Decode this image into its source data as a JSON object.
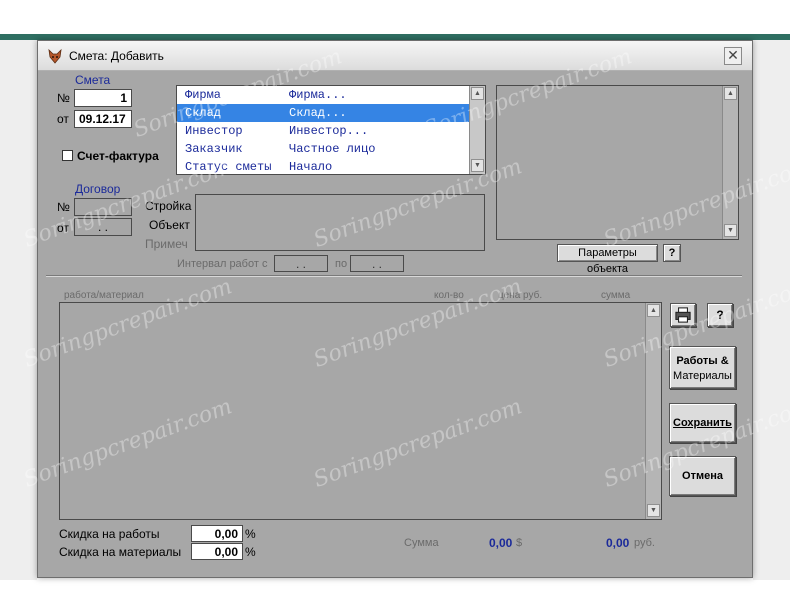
{
  "window": {
    "title": "Смета: Добавить",
    "close_symbol": "✕"
  },
  "estimate": {
    "group_label": "Смета",
    "number_label": "№",
    "number_value": "1",
    "date_label": "от",
    "date_value": "09.12.17",
    "invoice_label": "Счет-фактура",
    "invoice_checked": false
  },
  "contract": {
    "group_label": "Договор",
    "number_label": "№",
    "number_value": "",
    "date_label": "от",
    "date_value": ". ."
  },
  "parties_list": {
    "rows": [
      {
        "name": "Фирма",
        "value": "Фирма...",
        "selected": false
      },
      {
        "name": "Склад",
        "value": "Склад...",
        "selected": true
      },
      {
        "name": "Инвестор",
        "value": "Инвестор...",
        "selected": false
      },
      {
        "name": "Заказчик",
        "value": "Частное лицо",
        "selected": false
      },
      {
        "name": "Статус сметы",
        "value": "Начало",
        "selected": false
      }
    ]
  },
  "object_info": {
    "construction_label": "Стройка",
    "object_label": "Объект",
    "note_label": "Примеч",
    "interval_label": "Интервал работ с",
    "interval_from": ". .",
    "interval_to_label": "по",
    "interval_to": ". ."
  },
  "object_params_button": "Параметры объекта",
  "help_label": "?",
  "items_table": {
    "columns": [
      "работа/материал",
      "кол-во",
      "цена руб.",
      "сумма"
    ]
  },
  "side_buttons": {
    "works_materials_line1": "Работы &",
    "works_materials_line2": "Материалы",
    "save": "Сохранить",
    "cancel": "Отмена"
  },
  "discounts": {
    "works_label": "Скидка на работы",
    "works_value": "0,00",
    "materials_label": "Скидка на материалы",
    "materials_value": "0,00",
    "percent": "%"
  },
  "totals": {
    "sum_label": "Сумма",
    "usd_value": "0,00",
    "usd_unit": "$",
    "rub_value": "0,00",
    "rub_unit": "руб."
  },
  "watermark_text": "Soringpcrepair.com",
  "colors": {
    "window_bg": "#a7a7a7",
    "label_blue": "#1b2a9a",
    "selection": "#3584e4",
    "value_blue": "#1b2a9a"
  }
}
